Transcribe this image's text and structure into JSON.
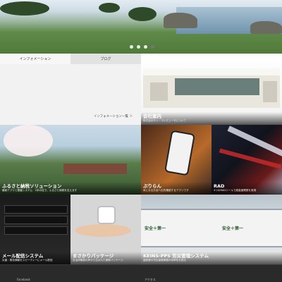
{
  "hero": {
    "slide_count": 4,
    "active_slide": 4
  },
  "tabs": [
    {
      "label": "インフォメーション",
      "active": true
    },
    {
      "label": "ブログ",
      "active": false
    }
  ],
  "info": {
    "link_label": "インフォメーション一覧 ＞"
  },
  "tiles": {
    "company": {
      "title": "会社案内",
      "subtitle": "株式会社サン・コンピュータについて"
    },
    "furusato": {
      "title": "ふるさと納税ソリューション",
      "subtitle": "最新アプリと基盤システム　2本の柱で、ふるさと納税を支えます"
    },
    "purin": {
      "title": "ぷりらん",
      "subtitle": "気になるお店へ出先確認するアプリです"
    },
    "rad": {
      "title": "RAD",
      "subtitle": "4つのRADツールで超高速開発を実現"
    },
    "mail": {
      "title": "メール配信システム",
      "subtitle": "災害・緊急情報をスピーディーにメール配信"
    },
    "mamakari": {
      "title": "まさかりパッケージ",
      "subtitle": "自治体職員の声から生まれた基幹パッケージ"
    },
    "keins": {
      "title": "KEINS-PPS 労災管理システム",
      "subtitle": "建設業の労災保険事務の効率化を図る"
    }
  },
  "sign_text": "安全＋第一",
  "footer": {
    "item1": "Facebook",
    "item2": "アクセス"
  },
  "colors": {
    "footer_bg": "#2a2a2a",
    "info_bg": "#f2f2f2"
  }
}
